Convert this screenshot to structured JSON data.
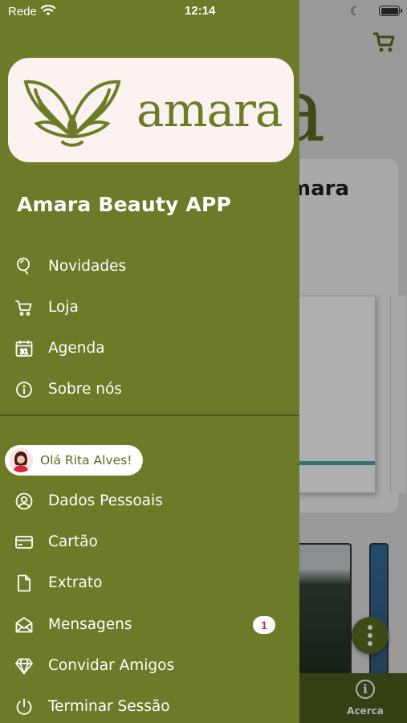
{
  "status_bar": {
    "carrier": "Rede",
    "time": "12:14"
  },
  "background": {
    "brand_fragment": "a",
    "card_title": "mara",
    "tab_acerca_label": "Acerca"
  },
  "drawer": {
    "logo_word": "amara",
    "app_title": "Amara Beauty APP",
    "main_menu": [
      {
        "label": "Novidades",
        "icon": "balloon-icon"
      },
      {
        "label": "Loja",
        "icon": "cart-icon"
      },
      {
        "label": "Agenda",
        "icon": "calendar-icon"
      },
      {
        "label": "Sobre nós",
        "icon": "info-icon"
      }
    ],
    "greeting": "Olá Rita Alves!",
    "account_menu": [
      {
        "label": "Dados Pessoais",
        "icon": "user-circle-icon"
      },
      {
        "label": "Cartão",
        "icon": "credit-card-icon"
      },
      {
        "label": "Extrato",
        "icon": "document-icon"
      },
      {
        "label": "Mensagens",
        "icon": "envelope-icon",
        "badge": "1"
      },
      {
        "label": "Convidar Amigos",
        "icon": "diamond-icon"
      },
      {
        "label": "Terminar Sessão",
        "icon": "power-icon"
      }
    ]
  },
  "colors": {
    "drawer_bg": "#6b7b27",
    "logo_card_bg": "#fbf1ee",
    "badge_text": "#d42b4e"
  }
}
